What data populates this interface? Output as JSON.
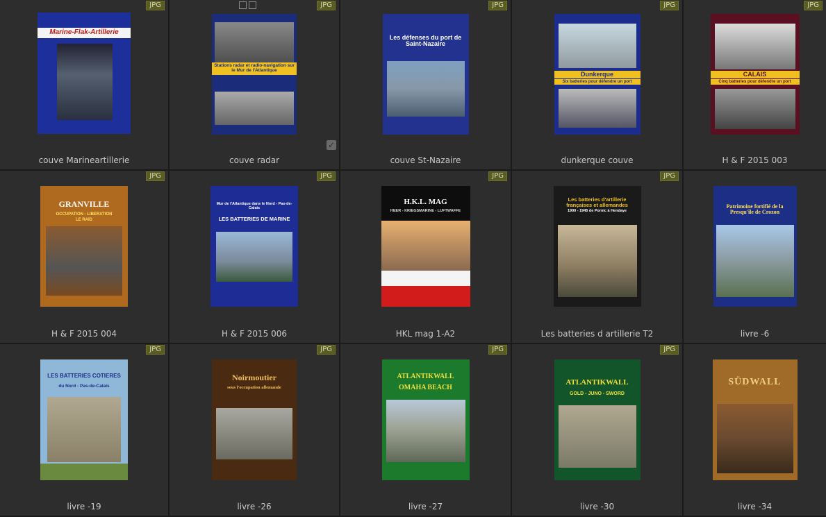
{
  "badge": "JPG",
  "items": [
    {
      "caption": "couve Marineartillerie",
      "cover_title": "Marine-Flak-Artillerie",
      "cover_bg": "#1c2f9a"
    },
    {
      "caption": "couve radar",
      "cover_title": "Stations radar et radio-navigation sur le Mur de l'Atlantique",
      "cover_bg": "#1a2c7a"
    },
    {
      "caption": "couve St-Nazaire",
      "cover_title": "Les défenses du port de Saint-Nazaire",
      "cover_bg": "#22328e"
    },
    {
      "caption": "dunkerque couve",
      "cover_title": "Dunkerque",
      "cover_subtitle": "Six batteries pour défendre un port",
      "cover_bg": "#1b2c8c"
    },
    {
      "caption": "H & F 2015 003",
      "cover_title": "CALAIS",
      "cover_subtitle": "Cinq batteries pour défendre un port",
      "cover_bg": "#5a1020"
    },
    {
      "caption": "H & F 2015 004",
      "cover_title": "GRANVILLE",
      "cover_subtitle": "OCCUPATION - LIBERATION",
      "cover_subtitle2": "LE RAID",
      "cover_bg": "#b06a20"
    },
    {
      "caption": "H & F 2015 006",
      "cover_title": "LES BATTERIES DE MARINE",
      "cover_subtitle": "Mur de l'Atlantique dans le Nord - Pas-de-Calais",
      "cover_bg": "#1d2d95"
    },
    {
      "caption": "HKL mag 1-A2",
      "cover_title": "H.K.L. MAG",
      "cover_subtitle": "HEER - KRIEGSMARINE - LUFTWAFFE",
      "cover_bg": "#0d0d0d"
    },
    {
      "caption": "Les batteries d artillerie T2",
      "cover_title": "Les batteries d'artillerie françaises et allemandes",
      "cover_subtitle": "1900 - 1945 de Pornic à Hendaye",
      "cover_bg": "#1a1a1a"
    },
    {
      "caption": "livre -6",
      "cover_title": "Patrimoine fortifié de la Presqu'île de Crozon",
      "cover_bg": "#1c2e85"
    },
    {
      "caption": "livre -19",
      "cover_title": "LES BATTERIES COTIERES",
      "cover_subtitle": "du Nord - Pas-de-Calais",
      "cover_bg": "#8fb8d8"
    },
    {
      "caption": "livre -26",
      "cover_title": "Noirmoutier",
      "cover_subtitle": "sous l'occupation allemande",
      "cover_bg": "#4a2a10"
    },
    {
      "caption": "livre -27",
      "cover_title": "ATLANTIKWALL",
      "cover_subtitle": "OMAHA BEACH",
      "cover_bg": "#1c7a2c"
    },
    {
      "caption": "livre -30",
      "cover_title": "ATLANTIKWALL",
      "cover_subtitle": "GOLD - JUNO - SWORD",
      "cover_bg": "#12552a"
    },
    {
      "caption": "livre -34",
      "cover_title": "SÜDWALL",
      "cover_bg": "#a06a28"
    }
  ]
}
